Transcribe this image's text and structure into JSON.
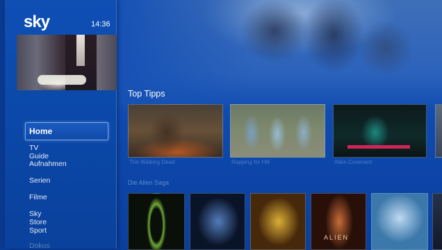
{
  "app": {
    "logo_text": "sky",
    "clock": "14:36"
  },
  "sidebar": {
    "active_item": "Home",
    "items": [
      {
        "label": "TV Guide"
      },
      {
        "label": "Aufnahmen"
      },
      {
        "label": "Serien"
      },
      {
        "label": "Filme"
      },
      {
        "label": "Sky Store"
      },
      {
        "label": "Sport"
      },
      {
        "label": "Dokus"
      }
    ]
  },
  "content": {
    "section1_title": "Top Tipps",
    "section2_title": "Die Alien Saga",
    "tile_captions": [
      "The Walking Dead",
      "Rapping for Hill",
      "Alien Covenant"
    ],
    "poster_text": "ALIEN"
  },
  "colors": {
    "accent": "#0b49aa",
    "highlight_border": "#7ea7e6",
    "red_accent": "#d0245a"
  }
}
